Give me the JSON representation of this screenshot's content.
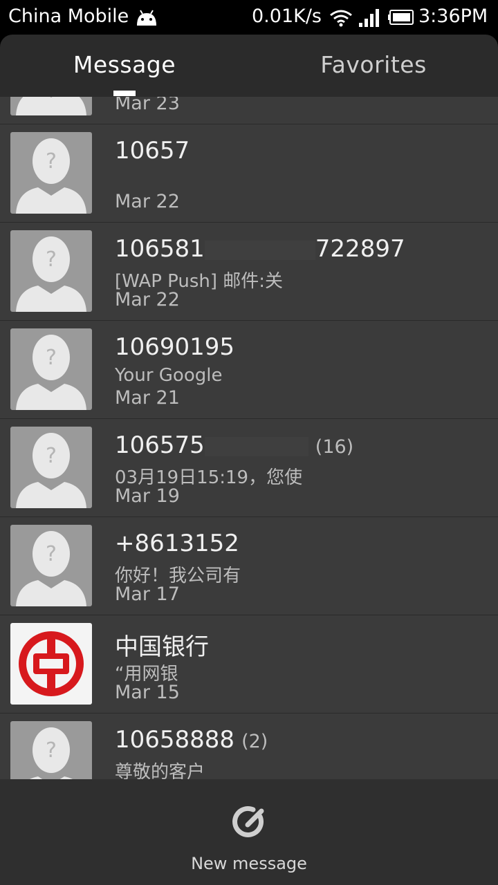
{
  "status_bar": {
    "carrier": "China Mobile",
    "net_speed": "0.01K/s",
    "time": "3:36PM",
    "icons": [
      "android-icon",
      "wifi-icon",
      "signal-icon",
      "battery-icon"
    ]
  },
  "tabs": {
    "message": "Message",
    "favorites": "Favorites",
    "active": "Message"
  },
  "messages": [
    {
      "sender": "",
      "snippet": "",
      "date": "Mar 23",
      "count": "",
      "avatar": "contact-placeholder"
    },
    {
      "sender": "10657",
      "snippet": "",
      "date": "Mar 22",
      "count": "",
      "avatar": "contact-placeholder"
    },
    {
      "sender": "106581",
      "sender_suffix": "722897",
      "snippet": "[WAP Push] 邮件:关",
      "date": "Mar 22",
      "count": "",
      "avatar": "contact-placeholder"
    },
    {
      "sender": "10690195",
      "snippet": "Your Google",
      "date": "Mar 21",
      "count": "",
      "avatar": "contact-placeholder"
    },
    {
      "sender": "106575",
      "snippet": "03月19日15:19，您使",
      "date": "Mar 19",
      "count": "(16)",
      "avatar": "contact-placeholder"
    },
    {
      "sender": "+8613152",
      "snippet": "你好！我公司有",
      "date": "Mar 17",
      "count": "",
      "avatar": "contact-placeholder"
    },
    {
      "sender": "中国银行",
      "snippet": "“用网银",
      "date": "Mar 15",
      "count": "",
      "avatar": "bank-of-china-logo"
    },
    {
      "sender": "10658888",
      "snippet": "尊敬的客户",
      "date": "",
      "count": "(2)",
      "avatar": "contact-placeholder"
    }
  ],
  "bottom_bar": {
    "new_message_label": "New message",
    "icon": "compose-icon"
  },
  "colors": {
    "list_background": "#3b3b3b",
    "header_background": "#2b2b2b",
    "bottom_background": "#2f2f2f",
    "bank_logo_red": "#d7191d"
  }
}
